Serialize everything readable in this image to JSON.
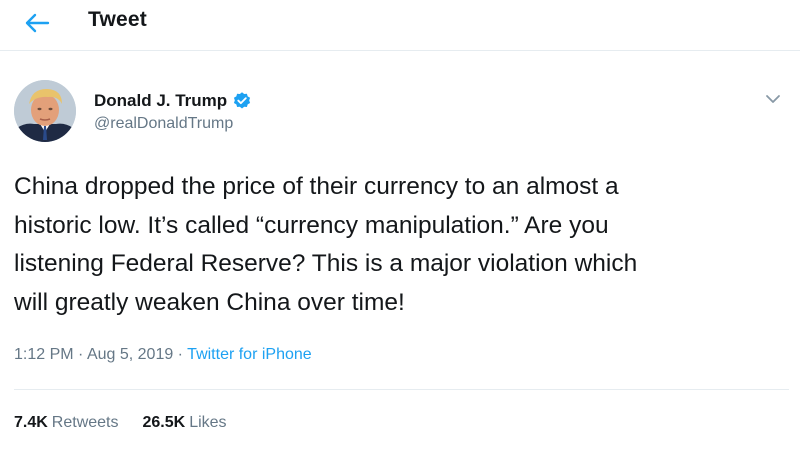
{
  "header": {
    "title": "Tweet",
    "back_icon": "arrow-left-icon"
  },
  "author": {
    "display_name": "Donald J. Trump",
    "handle": "@realDonaldTrump",
    "verified_icon": "verified-badge-icon",
    "avatar": "profile-photo"
  },
  "tweet": {
    "text": "China dropped the price of their currency to an almost a\nhistoric low. It’s called “currency manipulation.” Are you\nlistening Federal Reserve? This is a major violation which\nwill greatly weaken China over time!"
  },
  "meta": {
    "time": "1:12 PM",
    "separator": " · ",
    "date": "Aug 5, 2019",
    "source": "Twitter for iPhone"
  },
  "stats": {
    "retweets_count": "7.4K",
    "retweets_label": "Retweets",
    "likes_count": "26.5K",
    "likes_label": "Likes"
  },
  "colors": {
    "accent": "#1da1f2",
    "secondary_text": "#657786",
    "primary_text": "#14171a",
    "divider": "#e6ecf0"
  }
}
